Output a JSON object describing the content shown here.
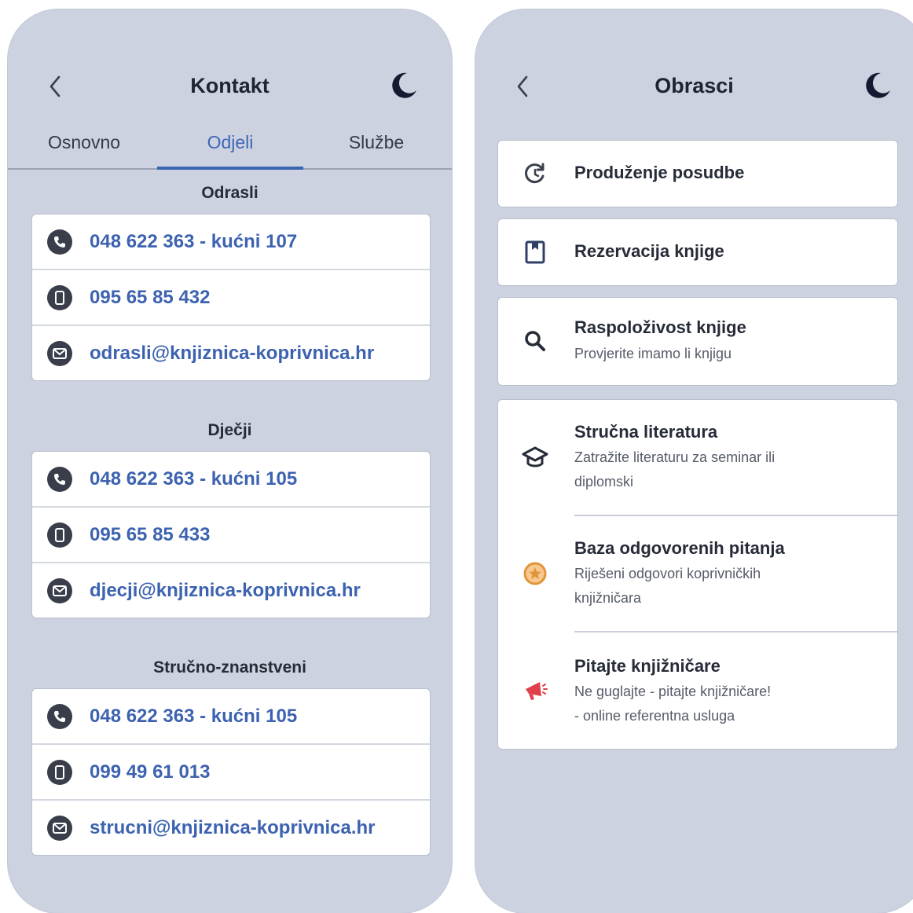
{
  "kontakt": {
    "title": "Kontakt",
    "tabs": [
      {
        "label": "Osnovno",
        "active": false
      },
      {
        "label": "Odjeli",
        "active": true
      },
      {
        "label": "Službe",
        "active": false
      }
    ],
    "sections": [
      {
        "title": "Odrasli",
        "rows": [
          {
            "icon": "phone-icon",
            "text": "048 622 363 - kućni 107"
          },
          {
            "icon": "mobile-icon",
            "text": "095 65 85 432"
          },
          {
            "icon": "mail-icon",
            "text": "odrasli@knjiznica-koprivnica.hr"
          }
        ]
      },
      {
        "title": "Dječji",
        "rows": [
          {
            "icon": "phone-icon",
            "text": "048 622 363 - kućni 105"
          },
          {
            "icon": "mobile-icon",
            "text": "095 65 85 433"
          },
          {
            "icon": "mail-icon",
            "text": "djecji@knjiznica-koprivnica.hr"
          }
        ]
      },
      {
        "title": "Stručno-znanstveni",
        "rows": [
          {
            "icon": "phone-icon",
            "text": "048 622 363 - kućni 105"
          },
          {
            "icon": "mobile-icon",
            "text": "099 49 61 013"
          },
          {
            "icon": "mail-icon",
            "text": "strucni@knjiznica-koprivnica.hr"
          }
        ]
      }
    ]
  },
  "obrasci": {
    "title": "Obrasci",
    "items": [
      {
        "icon": "renew-icon",
        "title": "Produženje posudbe"
      },
      {
        "icon": "book-icon",
        "title": "Rezervacija knjige"
      },
      {
        "icon": "search-icon",
        "title": "Raspoloživost knjige",
        "subtitle": "Provjerite imamo li knjigu"
      }
    ],
    "group": [
      {
        "icon": "graduation-cap-icon",
        "title": "Stručna literatura",
        "subtitle_lines": [
          "Zatražite literaturu za seminar ili",
          "diplomski"
        ]
      },
      {
        "icon": "star-badge-icon",
        "title": "Baza odgovorenih pitanja",
        "subtitle_lines": [
          "Riješeni odgovori koprivničkih",
          "knjižničara"
        ]
      },
      {
        "icon": "megaphone-icon",
        "title": "Pitajte knjižničare",
        "subtitle_lines": [
          "Ne guglajte - pitajte knjižničare!",
          "- online referentna usluga"
        ]
      }
    ]
  },
  "colors": {
    "accent": "#3c62b0",
    "background": "#ccd2e0",
    "star": "#f0a040",
    "megaphone": "#e0404c"
  }
}
